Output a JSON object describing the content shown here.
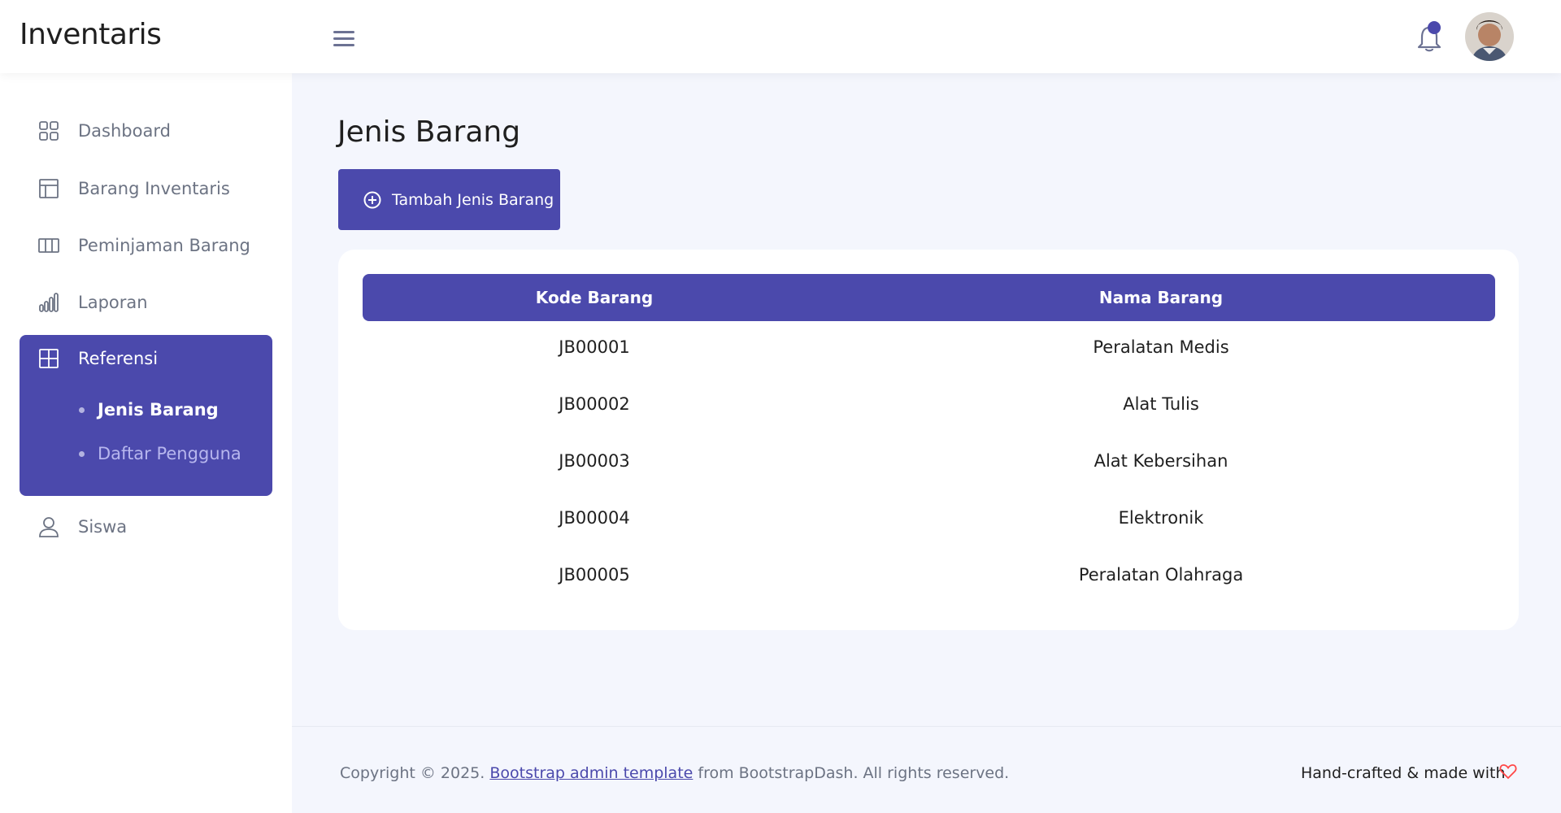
{
  "app": {
    "brand": "Inventaris"
  },
  "header": {
    "menu_icon": "hamburger-icon",
    "notification_icon": "bell-icon",
    "accent": "#4b49ac"
  },
  "sidebar": {
    "items": [
      {
        "label": "Dashboard",
        "icon": "grid-icon"
      },
      {
        "label": "Barang Inventaris",
        "icon": "layout-icon"
      },
      {
        "label": "Peminjaman Barang",
        "icon": "columns-icon"
      },
      {
        "label": "Laporan",
        "icon": "bar-chart-icon"
      },
      {
        "label": "Referensi",
        "icon": "table-icon",
        "active": true
      },
      {
        "label": "Siswa",
        "icon": "user-icon"
      }
    ],
    "sub_items": [
      {
        "label": "Jenis Barang",
        "active": true
      },
      {
        "label": "Daftar Pengguna",
        "active": false
      }
    ]
  },
  "main": {
    "title": "Jenis Barang",
    "add_button": "Tambah Jenis Barang",
    "table": {
      "headers": [
        "Kode Barang",
        "Nama Barang"
      ],
      "rows": [
        [
          "JB00001",
          "Peralatan Medis"
        ],
        [
          "JB00002",
          "Alat Tulis"
        ],
        [
          "JB00003",
          "Alat Kebersihan"
        ],
        [
          "JB00004",
          "Elektronik"
        ],
        [
          "JB00005",
          "Peralatan Olahraga"
        ]
      ]
    }
  },
  "footer": {
    "copyright_prefix": "Copyright © 2025. ",
    "link": "Bootstrap admin template",
    "copyright_suffix": " from BootstrapDash. All rights reserved.",
    "right_text": "Hand-crafted & made with",
    "heart_icon": "heart-icon",
    "heart_color": "#ff4747"
  }
}
